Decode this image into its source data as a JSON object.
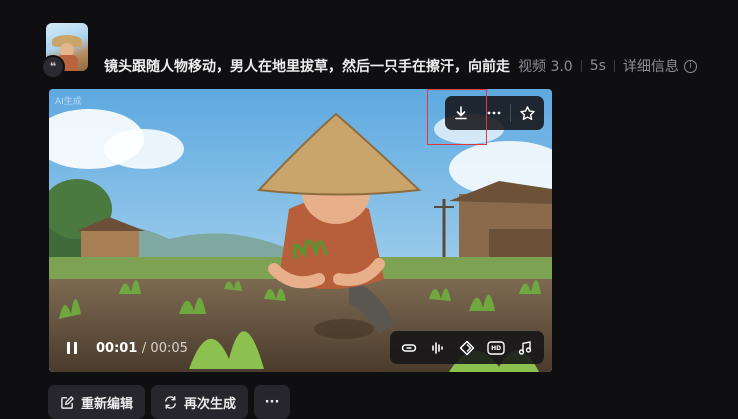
{
  "post": {
    "prompt": "镜头跟随人物移动，男人在地里拔草，然后一只手在擦汗，向前走",
    "model": "视频 3.0",
    "duration": "5s",
    "details_label": "详细信息",
    "quote_icon": "quote-icon",
    "info_icon": "info-icon"
  },
  "video": {
    "watermark": "AI生成",
    "current_time": "00:01",
    "total_time": "/ 00:05",
    "top_toolbar": [
      "download-icon",
      "more-icon",
      "star-icon"
    ],
    "bottom_toolbar": [
      "link-icon",
      "audio-wave-icon",
      "diamond-icon",
      "hd-icon",
      "music-icon"
    ],
    "hd_label": "HD"
  },
  "actions": {
    "reedit": "重新编辑",
    "regenerate": "再次生成",
    "more": "···"
  },
  "colors": {
    "background": "#0f0f12",
    "button_bg": "#26262c",
    "highlight": "#e0393e"
  }
}
